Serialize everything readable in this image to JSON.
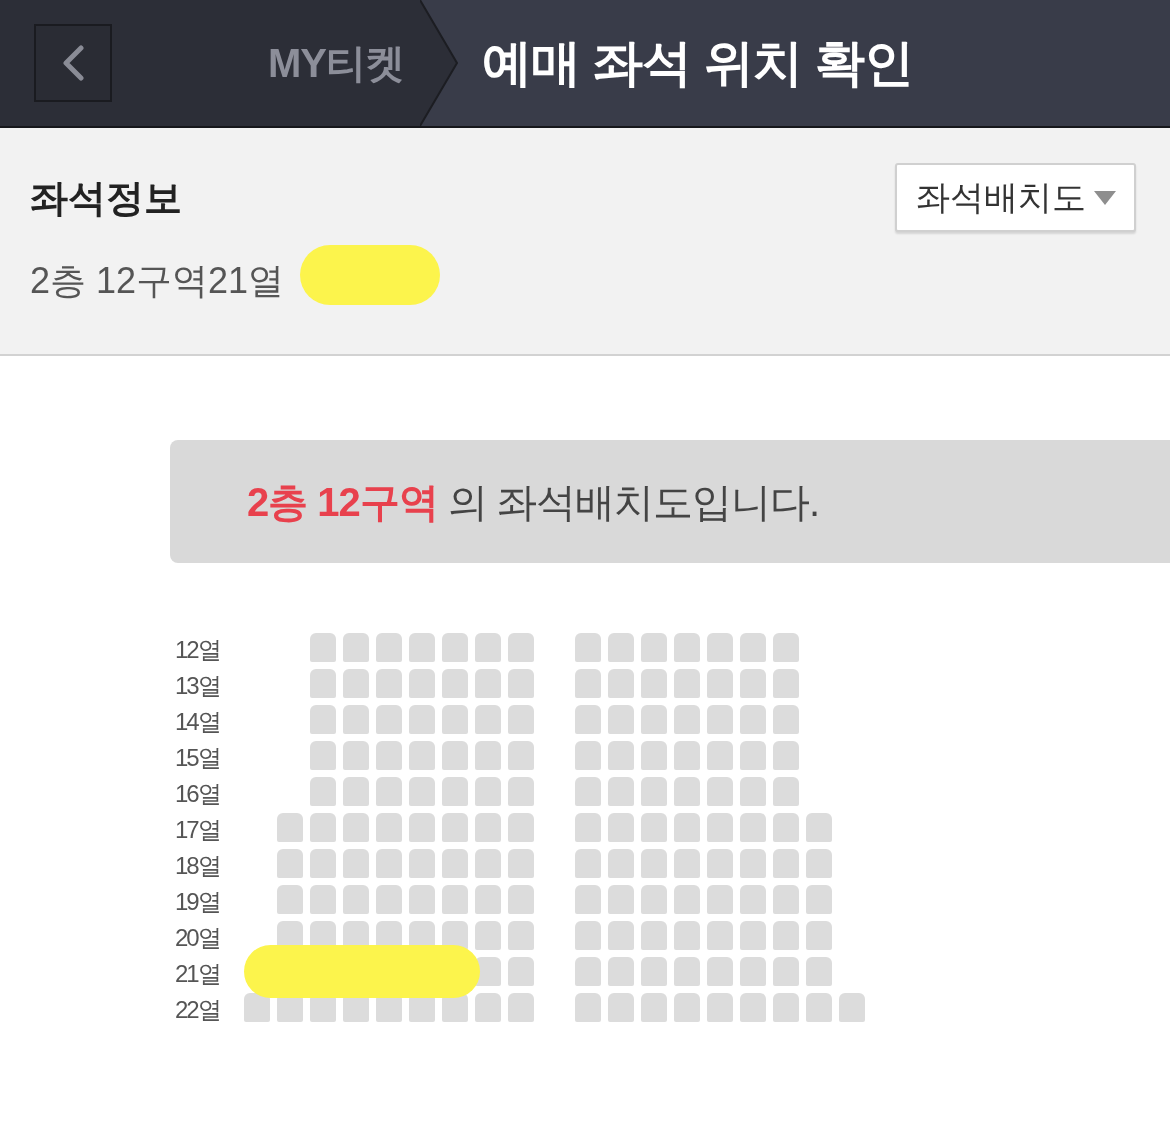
{
  "header": {
    "breadcrumb": "MY티켓",
    "title": "예매 좌석 위치 확인"
  },
  "seat_info": {
    "heading": "좌석정보",
    "value": "2층 12구역21열",
    "dropdown": {
      "label": "좌석배치도"
    }
  },
  "seat_map": {
    "caption": "**2층 12구역** 의 좌석배치도입니다.",
    "rows": [
      {
        "label": "12열",
        "left": [
          {
            "selected": false
          },
          {
            "selected": false
          },
          {
            "selected": false
          },
          {
            "selected": false
          },
          {
            "selected": false
          },
          {
            "selected": false
          },
          {
            "selected": false
          }
        ],
        "right": [
          {
            "selected": false
          },
          {
            "selected": false
          },
          {
            "selected": false
          },
          {
            "selected": false
          },
          {
            "selected": false
          },
          {
            "selected": false
          },
          {
            "selected": false
          }
        ]
      },
      {
        "label": "13열",
        "left": [
          {
            "selected": false
          },
          {
            "selected": false
          },
          {
            "selected": false
          },
          {
            "selected": false
          },
          {
            "selected": false
          },
          {
            "selected": false
          },
          {
            "selected": false
          }
        ],
        "right": [
          {
            "selected": false
          },
          {
            "selected": false
          },
          {
            "selected": false
          },
          {
            "selected": false
          },
          {
            "selected": false
          },
          {
            "selected": false
          },
          {
            "selected": false
          }
        ]
      },
      {
        "label": "14열",
        "left": [
          {
            "selected": false
          },
          {
            "selected": false
          },
          {
            "selected": false
          },
          {
            "selected": false
          },
          {
            "selected": false
          },
          {
            "selected": false
          },
          {
            "selected": false
          }
        ],
        "right": [
          {
            "selected": false
          },
          {
            "selected": false
          },
          {
            "selected": false
          },
          {
            "selected": false
          },
          {
            "selected": false
          },
          {
            "selected": false
          },
          {
            "selected": false
          }
        ]
      },
      {
        "label": "15열",
        "left": [
          {
            "selected": false
          },
          {
            "selected": false
          },
          {
            "selected": false
          },
          {
            "selected": false
          },
          {
            "selected": false
          },
          {
            "selected": false
          },
          {
            "selected": false
          }
        ],
        "right": [
          {
            "selected": false
          },
          {
            "selected": false
          },
          {
            "selected": false
          },
          {
            "selected": false
          },
          {
            "selected": false
          },
          {
            "selected": false
          },
          {
            "selected": false
          }
        ]
      },
      {
        "label": "16열",
        "left": [
          {
            "selected": false
          },
          {
            "selected": false
          },
          {
            "selected": false
          },
          {
            "selected": false
          },
          {
            "selected": false
          },
          {
            "selected": false
          },
          {
            "selected": false
          }
        ],
        "right": [
          {
            "selected": false
          },
          {
            "selected": false
          },
          {
            "selected": false
          },
          {
            "selected": false
          },
          {
            "selected": false
          },
          {
            "selected": false
          },
          {
            "selected": false
          }
        ]
      },
      {
        "label": "17열",
        "left": [
          {
            "selected": false
          },
          {
            "selected": false
          },
          {
            "selected": false
          },
          {
            "selected": false
          },
          {
            "selected": false
          },
          {
            "selected": false
          },
          {
            "selected": false
          },
          {
            "selected": false
          }
        ],
        "right": [
          {
            "selected": false
          },
          {
            "selected": false
          },
          {
            "selected": false
          },
          {
            "selected": false
          },
          {
            "selected": false
          },
          {
            "selected": false
          },
          {
            "selected": false
          },
          {
            "selected": false
          }
        ]
      },
      {
        "label": "18열",
        "left": [
          {
            "selected": false
          },
          {
            "selected": false
          },
          {
            "selected": false
          },
          {
            "selected": false
          },
          {
            "selected": false
          },
          {
            "selected": false
          },
          {
            "selected": false
          },
          {
            "selected": false
          }
        ],
        "right": [
          {
            "selected": false
          },
          {
            "selected": false
          },
          {
            "selected": false
          },
          {
            "selected": false
          },
          {
            "selected": false
          },
          {
            "selected": false
          },
          {
            "selected": false
          },
          {
            "selected": false
          }
        ]
      },
      {
        "label": "19열",
        "left": [
          {
            "selected": false
          },
          {
            "selected": false
          },
          {
            "selected": false
          },
          {
            "selected": false
          },
          {
            "selected": false
          },
          {
            "selected": false
          },
          {
            "selected": false
          },
          {
            "selected": false
          }
        ],
        "right": [
          {
            "selected": false
          },
          {
            "selected": false
          },
          {
            "selected": false
          },
          {
            "selected": false
          },
          {
            "selected": false
          },
          {
            "selected": false
          },
          {
            "selected": false
          },
          {
            "selected": false
          }
        ]
      },
      {
        "label": "20열",
        "left": [
          {
            "selected": false
          },
          {
            "selected": false
          },
          {
            "selected": false
          },
          {
            "selected": false
          },
          {
            "selected": false
          },
          {
            "selected": false
          },
          {
            "selected": false
          },
          {
            "selected": false
          }
        ],
        "right": [
          {
            "selected": false
          },
          {
            "selected": false
          },
          {
            "selected": false
          },
          {
            "selected": false
          },
          {
            "selected": false
          },
          {
            "selected": false
          },
          {
            "selected": false
          },
          {
            "selected": false
          }
        ]
      },
      {
        "label": "21열",
        "left": [
          {
            "selected": false
          },
          {
            "selected": false
          }
        ],
        "right": [
          {
            "selected": false
          },
          {
            "selected": false
          },
          {
            "selected": false
          },
          {
            "selected": false
          },
          {
            "selected": false
          },
          {
            "selected": false
          },
          {
            "selected": false
          },
          {
            "selected": false
          }
        ]
      },
      {
        "label": "22열",
        "left": [
          {
            "selected": false
          },
          {
            "selected": false
          },
          {
            "selected": false
          },
          {
            "selected": false
          },
          {
            "selected": false
          },
          {
            "selected": false
          },
          {
            "selected": false
          },
          {
            "selected": false
          },
          {
            "selected": false
          }
        ],
        "right": [
          {
            "selected": false
          },
          {
            "selected": false
          },
          {
            "selected": false
          },
          {
            "selected": false
          },
          {
            "selected": false
          },
          {
            "selected": false
          },
          {
            "selected": false
          },
          {
            "selected": false
          },
          {
            "selected": false
          }
        ]
      }
    ]
  }
}
